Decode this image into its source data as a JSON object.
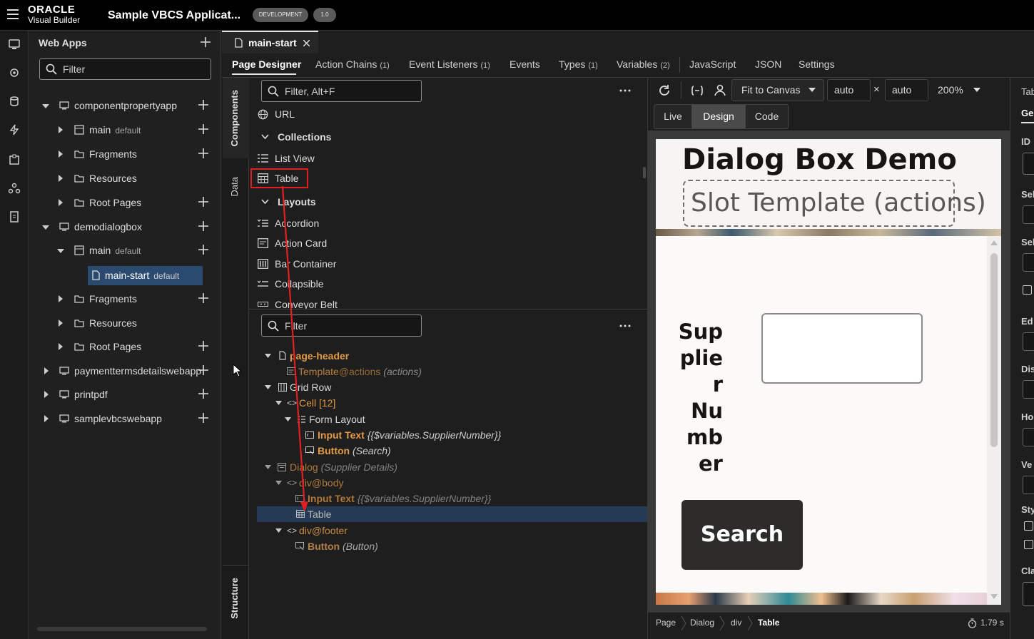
{
  "header": {
    "brand_top": "ORACLE",
    "brand_bottom": "Visual Builder",
    "app_title": "Sample VBCS Applicat...",
    "env_badge": "DEVELOPMENT",
    "version_badge": "1.0"
  },
  "webapps": {
    "title": "Web Apps",
    "filter_placeholder": "Filter",
    "tree": [
      {
        "label": "componentpropertyapp",
        "tag": ""
      },
      {
        "label": "main",
        "tag": "default"
      },
      {
        "label": "Fragments",
        "tag": ""
      },
      {
        "label": "Resources",
        "tag": ""
      },
      {
        "label": "Root Pages",
        "tag": ""
      },
      {
        "label": "demodialogbox",
        "tag": ""
      },
      {
        "label": "main",
        "tag": "default"
      },
      {
        "label": "main-start",
        "tag": "default"
      },
      {
        "label": "Fragments",
        "tag": ""
      },
      {
        "label": "Resources",
        "tag": ""
      },
      {
        "label": "Root Pages",
        "tag": ""
      },
      {
        "label": "paymenttermsdetailswebapp",
        "tag": ""
      },
      {
        "label": "printpdf",
        "tag": ""
      },
      {
        "label": "samplevbcswebapp",
        "tag": ""
      }
    ]
  },
  "editor": {
    "file_tab": "main-start",
    "tabs": [
      {
        "label": "Page Designer",
        "count": ""
      },
      {
        "label": "Action Chains",
        "count": "(1)"
      },
      {
        "label": "Event Listeners",
        "count": "(1)"
      },
      {
        "label": "Events",
        "count": ""
      },
      {
        "label": "Types",
        "count": "(1)"
      },
      {
        "label": "Variables",
        "count": "(2)"
      },
      {
        "label": "JavaScript",
        "count": ""
      },
      {
        "label": "JSON",
        "count": ""
      },
      {
        "label": "Settings",
        "count": ""
      }
    ],
    "vtabs": {
      "components": "Components",
      "data": "Data",
      "structure": "Structure"
    }
  },
  "components": {
    "filter_placeholder": "Filter, Alt+F",
    "items": [
      {
        "label": "URL",
        "icon": "globe-icon"
      },
      {
        "label": "Collections",
        "icon": "chevron-down-icon",
        "group": true
      },
      {
        "label": "List View",
        "icon": "list-icon"
      },
      {
        "label": "Table",
        "icon": "table-icon"
      },
      {
        "label": "Layouts",
        "icon": "chevron-down-icon",
        "group": true
      },
      {
        "label": "Accordion",
        "icon": "accordion-icon"
      },
      {
        "label": "Action Card",
        "icon": "card-icon"
      },
      {
        "label": "Bar Container",
        "icon": "bar-icon"
      },
      {
        "label": "Collapsible",
        "icon": "collapsible-icon"
      },
      {
        "label": "Conveyor Belt",
        "icon": "conveyor-icon"
      }
    ]
  },
  "structure": {
    "filter_placeholder": "Filter",
    "rows": [
      {
        "name": "page-header",
        "suffix": "",
        "extra": ""
      },
      {
        "name": "Template",
        "suffix": "@actions",
        "extra": "(actions)"
      },
      {
        "name": "Grid Row",
        "suffix": "",
        "extra": ""
      },
      {
        "name": "Cell [12]",
        "suffix": "",
        "extra": ""
      },
      {
        "name": "Form Layout",
        "suffix": "",
        "extra": ""
      },
      {
        "name": "Input Text",
        "suffix": "",
        "extra": "{{$variables.SupplierNumber}}"
      },
      {
        "name": "Button",
        "suffix": "",
        "extra": "(Search)"
      },
      {
        "name": "Dialog",
        "suffix": "",
        "extra": "(Supplier Details)"
      },
      {
        "name": "div",
        "suffix": "@body",
        "extra": ""
      },
      {
        "name": "Input Text",
        "suffix": "",
        "extra": "{{$variables.SupplierNumber}}"
      },
      {
        "name": "Table",
        "suffix": "",
        "extra": ""
      },
      {
        "name": "div",
        "suffix": "@footer",
        "extra": ""
      },
      {
        "name": "Button",
        "suffix": "",
        "extra": "(Button)"
      }
    ]
  },
  "toolbar": {
    "fit": "Fit to Canvas",
    "width": "auto",
    "height": "auto",
    "times": "×",
    "zoom": "200%",
    "modes": [
      "Live",
      "Design",
      "Code"
    ]
  },
  "canvas": {
    "title": "Dialog Box Demo",
    "slot": "Slot Template (actions)",
    "label_lines": [
      "Sup",
      "plie",
      "r",
      "Nu",
      "mb",
      "er"
    ],
    "search": "Search"
  },
  "breadcrumb": {
    "items": [
      "Page",
      "Dialog",
      "div",
      "Table"
    ],
    "timing": "1.79 s"
  },
  "properties": {
    "tab_partial": "Tab",
    "general_partial": "Ge",
    "labels": [
      "ID",
      "Sel",
      "Sel",
      "Ed",
      "Dis",
      "Ho",
      "Ve",
      "Sty",
      "Cla"
    ]
  },
  "colors": {
    "accent": "#e4e4e4",
    "selection": "#2b4a6f",
    "highlight_box": "#e02020",
    "orange": "#e39b48"
  }
}
